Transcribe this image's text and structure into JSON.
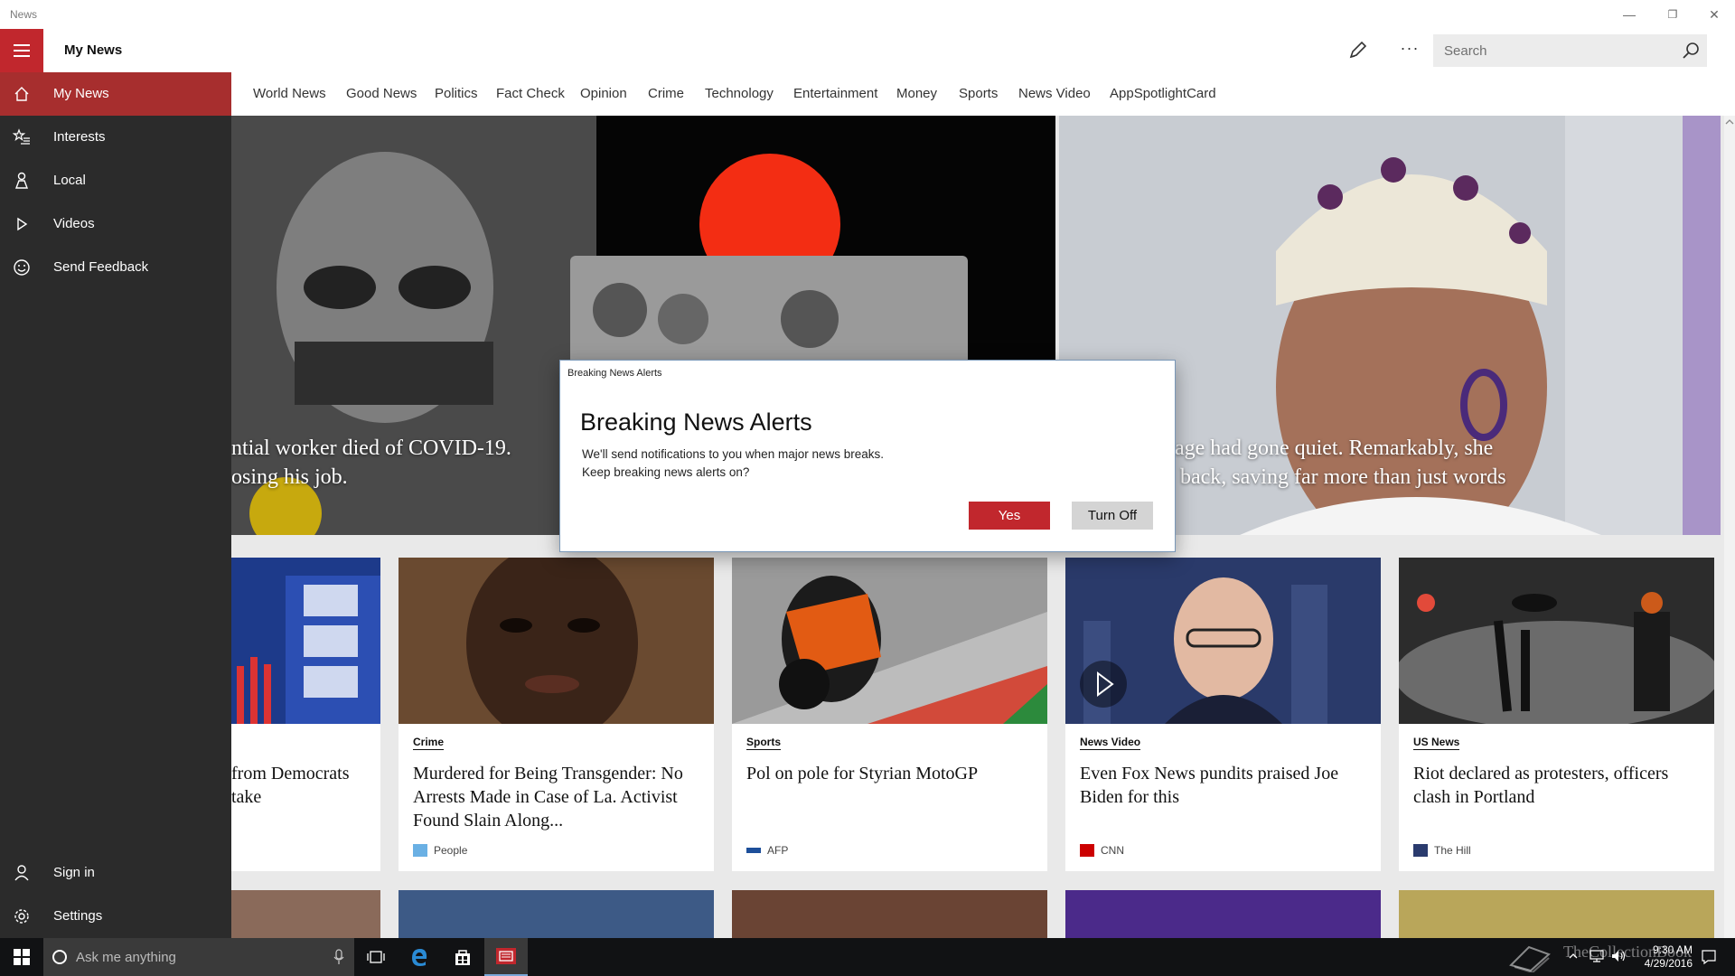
{
  "window": {
    "app_title": "News",
    "controls": {
      "minimize": "—",
      "maximize": "❐",
      "close": "✕"
    }
  },
  "header": {
    "page_title": "My News",
    "more_label": "···",
    "search_placeholder": "Search"
  },
  "sidebar": {
    "items": [
      {
        "label": "My News",
        "icon": "home-icon",
        "active": true
      },
      {
        "label": "Interests",
        "icon": "star-list-icon",
        "active": false
      },
      {
        "label": "Local",
        "icon": "person-location-icon",
        "active": false
      },
      {
        "label": "Videos",
        "icon": "play-icon",
        "active": false
      },
      {
        "label": "Send Feedback",
        "icon": "smiley-icon",
        "active": false
      }
    ],
    "bottom_items": [
      {
        "label": "Sign in",
        "icon": "person-icon"
      },
      {
        "label": "Settings",
        "icon": "gear-icon"
      }
    ]
  },
  "tabs": [
    "World News",
    "Good News",
    "Politics",
    "Fact Check",
    "Opinion",
    "Crime",
    "Technology",
    "Entertainment",
    "Money",
    "Sports",
    "News Video",
    "AppSpotlightCard"
  ],
  "hero": {
    "left_caption_line1": "ntial worker died of COVID-19.",
    "left_caption_line2": "osing his job.",
    "right_caption_line1": "age had gone quiet. Remarkably, she",
    "right_caption_line2": "back, saving far more than just words"
  },
  "cards": [
    {
      "category": "",
      "headline_line1": "from Democrats",
      "headline_line2": "take",
      "source": ""
    },
    {
      "category": "Crime",
      "headline": "Murdered for Being Transgender: No Arrests Made in Case of La. Activist Found Slain Along...",
      "source": "People"
    },
    {
      "category": "Sports",
      "headline": "Pol on pole for Styrian MotoGP",
      "source": "AFP"
    },
    {
      "category": "News Video",
      "headline": "Even Fox News pundits praised Joe Biden for this",
      "source": "CNN"
    },
    {
      "category": "US News",
      "headline": "Riot declared as protesters, officers clash in Portland",
      "source": "The Hill"
    }
  ],
  "dialog": {
    "caption": "Breaking News Alerts",
    "title": "Breaking News Alerts",
    "body_line1": "We'll send notifications to you when major news breaks.",
    "body_line2": "Keep breaking news alerts on?",
    "yes_label": "Yes",
    "off_label": "Turn Off"
  },
  "taskbar": {
    "search_placeholder": "Ask me anything",
    "time": "9:30 AM",
    "date": "4/29/2016",
    "watermark": "TheCollectionBook"
  },
  "colors": {
    "accent": "#c1272d",
    "sidebar_bg": "#2b2b2b",
    "active_nav": "#a72e2e",
    "taskbar_bg": "#111214"
  }
}
